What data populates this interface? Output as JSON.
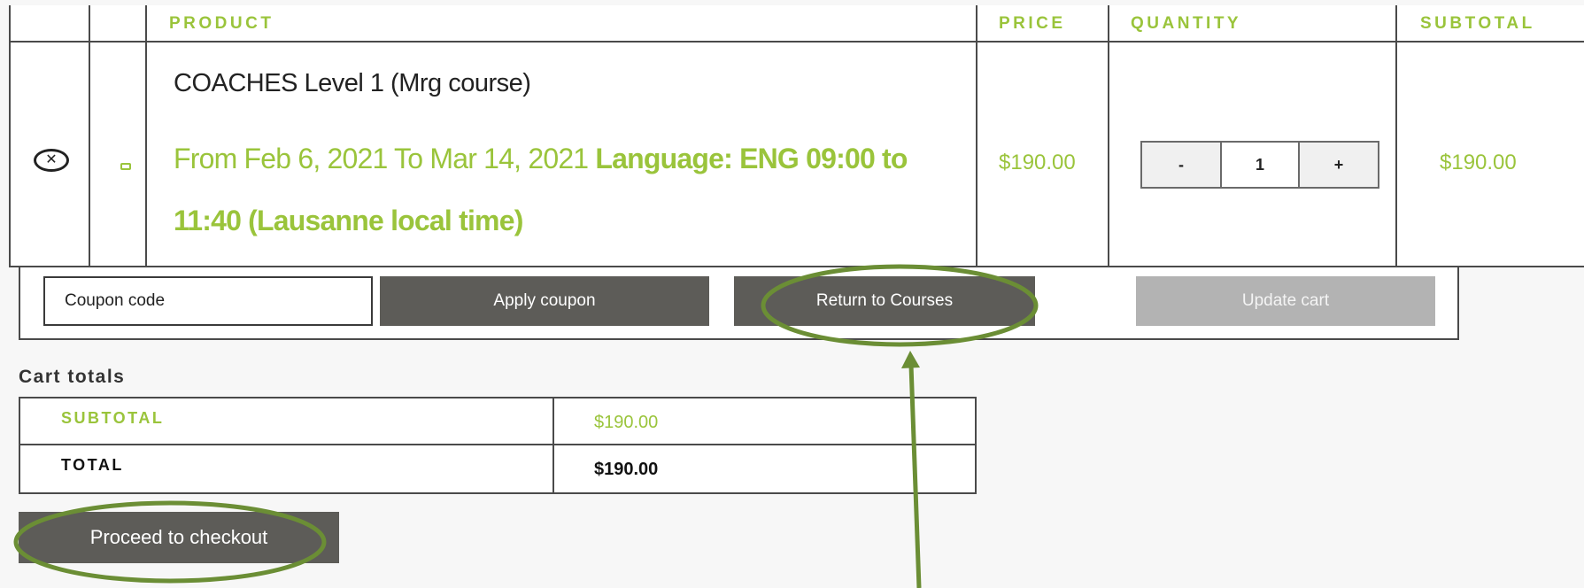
{
  "cart_table": {
    "headers": {
      "product": "PRODUCT",
      "price": "PRICE",
      "quantity": "QUANTITY",
      "subtotal": "SUBTOTAL"
    },
    "row": {
      "remove_icon": "close-circle-icon",
      "thumbnail_icon": "product-thumbnail-icon",
      "name": "COACHES Level 1 (Mrg course)",
      "dates": "From Feb 6, 2021 To Mar 14, 2021",
      "language": "Language: ENG 09:00 to 11:40 (Lausanne local time)",
      "price": "$190.00",
      "quantity": {
        "minus": "-",
        "value": "1",
        "plus": "+"
      },
      "subtotal": "$190.00"
    }
  },
  "actions": {
    "coupon_placeholder": "Coupon code",
    "apply_coupon": "Apply coupon",
    "return_to_courses": "Return to Courses",
    "update_cart": "Update cart"
  },
  "cart_totals": {
    "heading": "Cart totals",
    "subtotal_label": "SUBTOTAL",
    "subtotal_value": "$190.00",
    "total_label": "TOTAL",
    "total_value": "$190.00"
  },
  "checkout": {
    "label": "Proceed to checkout"
  },
  "colors": {
    "accent_green": "#9ac43b",
    "annotation_green": "#6b8e35",
    "button_dark": "#5d5c58",
    "button_disabled": "#b3b3b3"
  }
}
